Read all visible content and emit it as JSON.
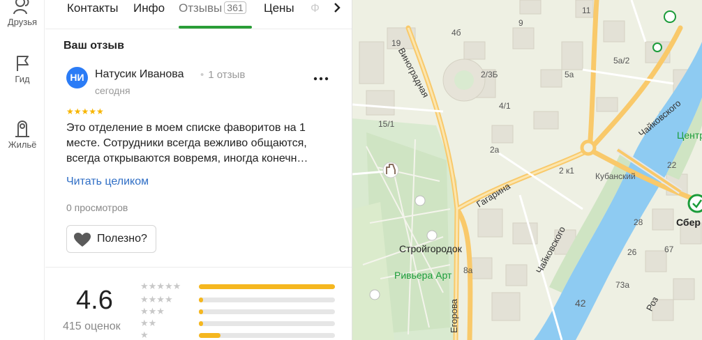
{
  "rail": {
    "items": [
      {
        "label": "Друзья",
        "icon": "friends-icon"
      },
      {
        "label": "Гид",
        "icon": "flag-icon"
      },
      {
        "label": "Жильё",
        "icon": "house-icon"
      }
    ]
  },
  "tabs": [
    {
      "label": "Контакты"
    },
    {
      "label": "Инфо"
    },
    {
      "label": "Отзывы",
      "count": "361",
      "active": true
    },
    {
      "label": "Цены"
    },
    {
      "label": "Ф"
    }
  ],
  "review": {
    "section_title": "Ваш отзыв",
    "avatar_initials": "НИ",
    "author": "Натусик Иванова",
    "author_reviews": "1 отзыв",
    "date": "сегодня",
    "stars": "★★★★★",
    "text_lines": [
      "Это отделение в моем списке фаворитов на 1",
      "месте. Сотрудники всегда вежливо общаются,",
      "всегда открываются вовремя, иногда конечн…"
    ],
    "read_more": "Читать целиком",
    "views": "0 просмотров",
    "useful_label": "Полезно?"
  },
  "rating": {
    "value": "4.6",
    "count_label": "415 оценок",
    "histogram": [
      {
        "stars": "★★★★★",
        "fraction": 1.0
      },
      {
        "stars": "★★★★",
        "fraction": 0.03
      },
      {
        "stars": "★★★",
        "fraction": 0.03
      },
      {
        "stars": "★★",
        "fraction": 0.03
      },
      {
        "stars": "★",
        "fraction": 0.16
      }
    ]
  },
  "map": {
    "labels": {
      "vinogradnaya": "Виноградная",
      "gagarina": "Гагарина",
      "chaikovskogo1": "Чайковского",
      "chaikovskogo2": "Чайковского",
      "kubanskiy": "Кубанский",
      "stroygorodok": "Стройгородок",
      "riviera": "Ривьера Арт",
      "egorova": "Егорова",
      "centr": "Центр",
      "sber": "Сбер",
      "roz": "Роз",
      "h9": "9",
      "h11": "11",
      "h19": "19",
      "h4b": "4б",
      "h5a2": "5а/2",
      "h2_3b": "2/3Б",
      "h5a": "5а",
      "h4_1": "4/1",
      "h15_1": "15/1",
      "h2a": "2а",
      "h2k1": "2 к1",
      "h22": "22",
      "h28": "28",
      "h26": "26",
      "h67": "67",
      "h73a": "73а",
      "h42": "42",
      "h8a": "8а"
    },
    "colors": {
      "river": "#8ecbf2",
      "road": "#f9c96a",
      "park": "#d6e8c2"
    }
  }
}
